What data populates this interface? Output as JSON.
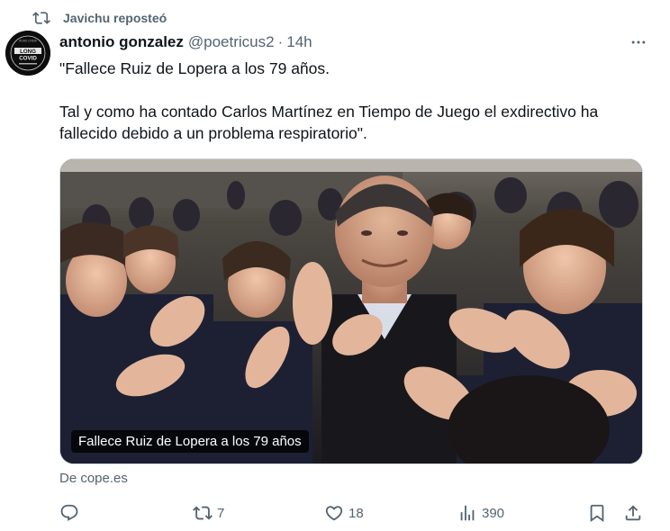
{
  "repost": {
    "label": "Javichu reposteó",
    "icon": "repost-icon"
  },
  "author": {
    "name": "antonio gonzalez",
    "handle": "@poetricus2",
    "separator": "·",
    "time": "14h",
    "avatar_text": "LONG COVID",
    "avatar_arc_text": "ROAD CREW"
  },
  "tweet": {
    "line1": "\"Fallece Ruiz de Lopera a los 79 años.",
    "line2": "Tal y como ha contado Carlos Martínez en Tiempo de Juego el exdirectivo ha fallecido debido a un problema respiratorio\"."
  },
  "card": {
    "caption": "Fallece Ruiz de Lopera a los 79 años",
    "source": "De cope.es"
  },
  "actions": {
    "reply": {
      "icon": "reply-icon",
      "count": ""
    },
    "repost": {
      "icon": "repost-icon",
      "count": "7"
    },
    "like": {
      "icon": "heart-icon",
      "count": "18"
    },
    "views": {
      "icon": "views-icon",
      "count": "390"
    },
    "bookmark": {
      "icon": "bookmark-icon"
    },
    "share": {
      "icon": "share-icon"
    }
  },
  "colors": {
    "text": "#0f1419",
    "secondary": "#536471",
    "border": "#cfd9de"
  }
}
